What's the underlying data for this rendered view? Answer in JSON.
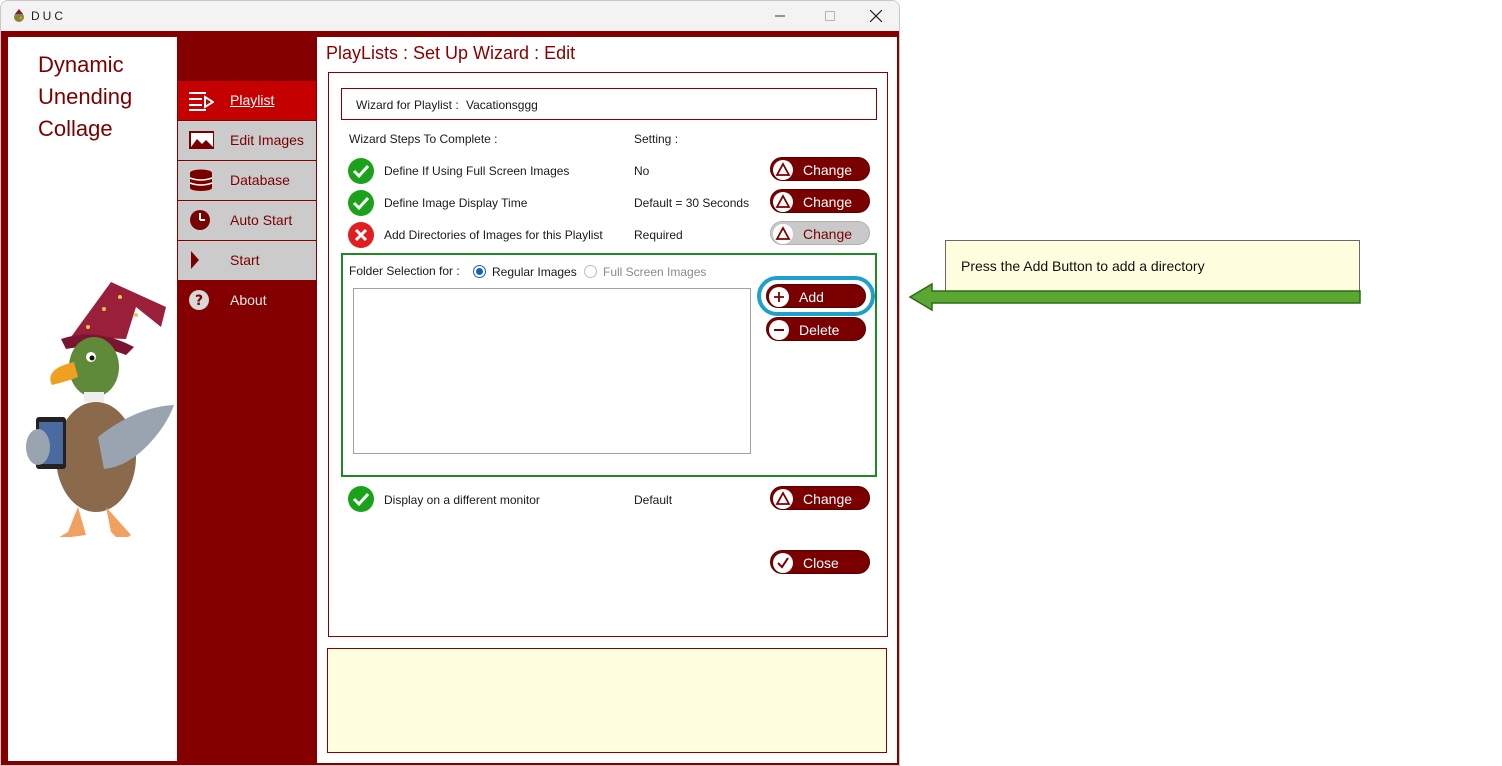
{
  "window": {
    "title": "DUC"
  },
  "logo": {
    "line1": "Dynamic",
    "line2": "Unending",
    "line3": "Collage"
  },
  "nav": [
    {
      "label": "Playlist",
      "icon": "playlist-icon"
    },
    {
      "label": "Edit Images",
      "icon": "image-icon"
    },
    {
      "label": "Database",
      "icon": "database-icon"
    },
    {
      "label": "Auto Start",
      "icon": "clock-icon"
    },
    {
      "label": "Start",
      "icon": "play-icon"
    },
    {
      "label": "About",
      "icon": "help-icon"
    }
  ],
  "page": {
    "title": "PlayLists : Set Up Wizard : Edit"
  },
  "wizard": {
    "name_label": "Wizard for Playlist :",
    "name_value": "Vacationsggg",
    "steps_header": "Wizard Steps To Complete :",
    "setting_header": "Setting :",
    "steps": [
      {
        "label": "Define If Using Full Screen Images",
        "setting": "No",
        "status": "done",
        "button": "Change"
      },
      {
        "label": "Define Image Display Time",
        "setting": "Default = 30 Seconds",
        "status": "done",
        "button": "Change"
      },
      {
        "label": "Add Directories of Images for this Playlist",
        "setting": "Required",
        "status": "error",
        "button": "Change"
      },
      {
        "label": "Display on a different monitor",
        "setting": "Default",
        "status": "done",
        "button": "Change"
      }
    ],
    "folder": {
      "label": "Folder Selection for :",
      "option_regular": "Regular Images",
      "option_fullscreen": "Full Screen Images",
      "selected": "Regular Images",
      "add_label": "Add",
      "delete_label": "Delete"
    },
    "close_label": "Close"
  },
  "callout": {
    "text": "Press the Add Button to add a directory"
  },
  "colors": {
    "brand": "#840000",
    "accent_red": "#c40000",
    "success": "#1aa31a",
    "highlight": "#1ea0cc",
    "arrow": "#5aa832"
  }
}
